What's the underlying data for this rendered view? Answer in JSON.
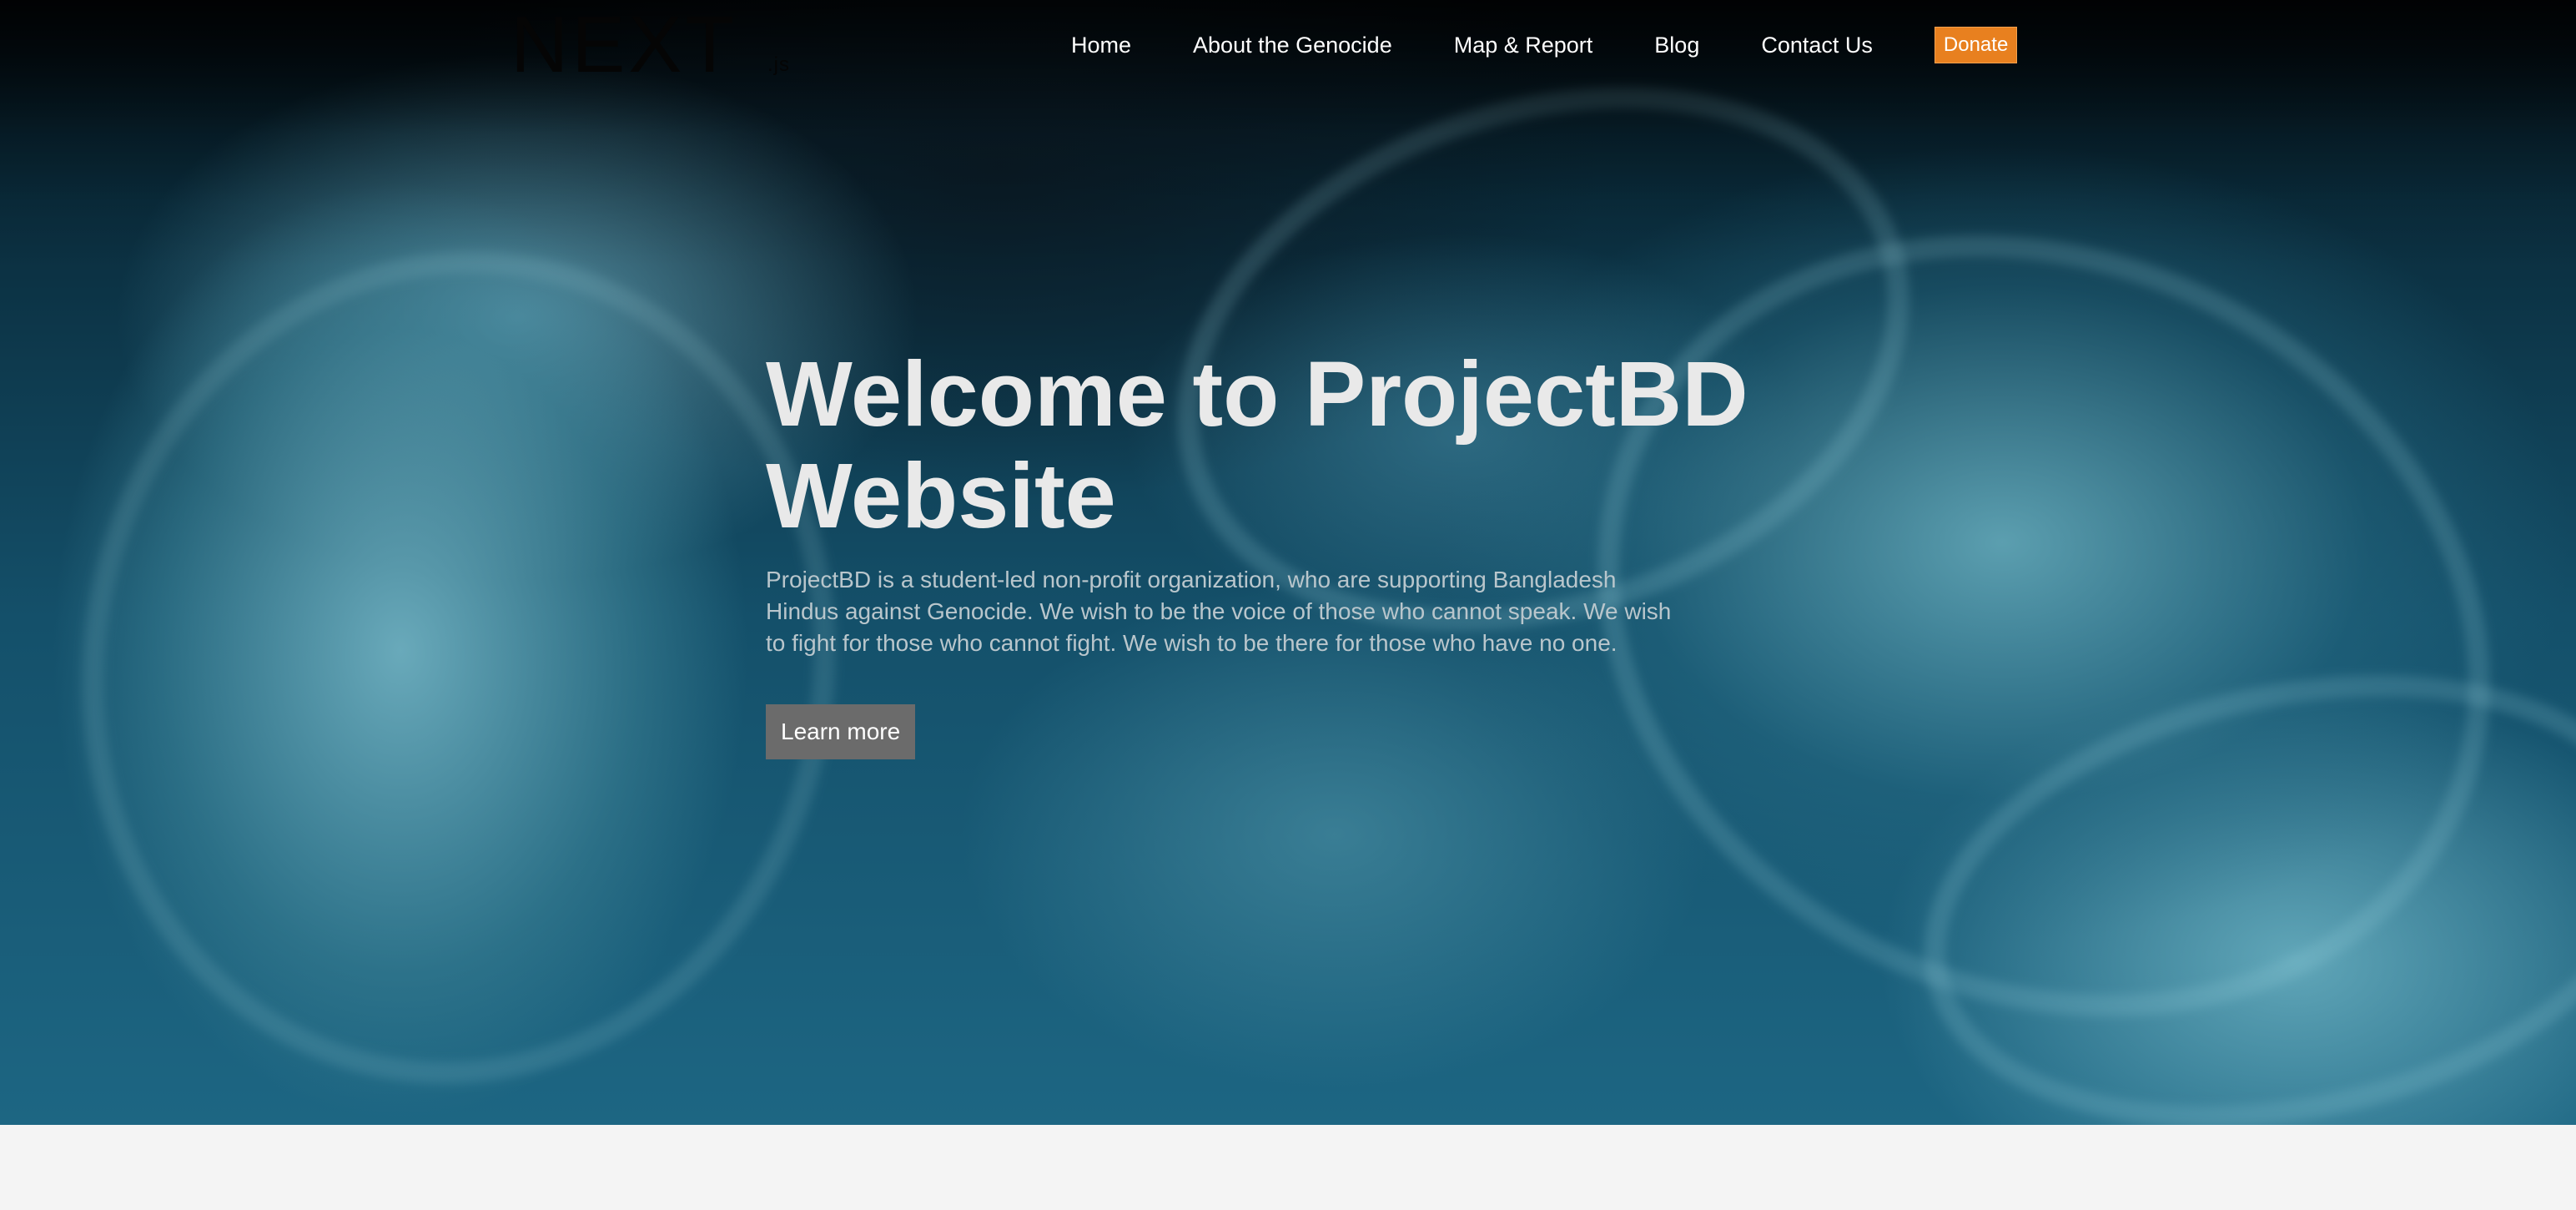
{
  "header": {
    "logo_text": "NEXT",
    "logo_sub": ".js",
    "nav": [
      {
        "label": "Home"
      },
      {
        "label": "About the Genocide"
      },
      {
        "label": "Map & Report"
      },
      {
        "label": "Blog"
      },
      {
        "label": "Contact Us"
      }
    ],
    "donate_label": "Donate"
  },
  "hero": {
    "title_line1": "Welcome to ProjectBD",
    "title_line2": "Website",
    "description": "ProjectBD is a student-led non-profit organization, who are supporting Bangladesh Hindus against Genocide. We wish to be the voice of those who cannot speak. We wish to fight for those who cannot fight. We wish to be there for those who have no one.",
    "cta_label": "Learn more"
  },
  "colors": {
    "accent": "#e8801f",
    "button_gray": "#6b6b6b",
    "title": "#e9e9e9",
    "page_bg": "#f4f4f4"
  }
}
